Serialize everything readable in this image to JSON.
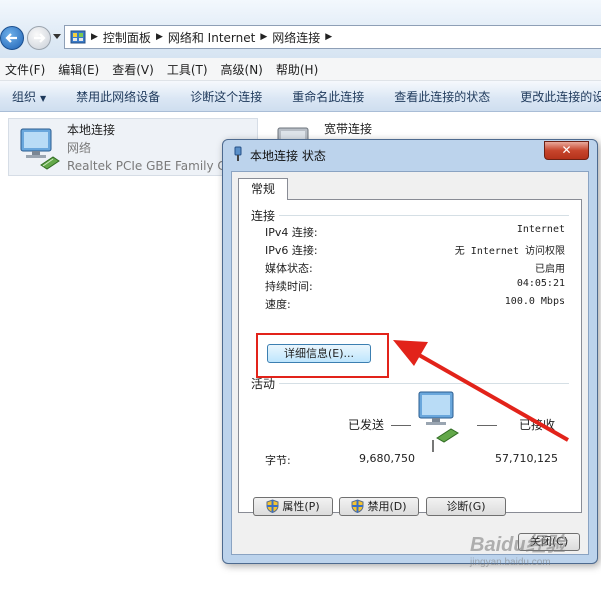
{
  "breadcrumbs": [
    "控制面板",
    "网络和 Internet",
    "网络连接"
  ],
  "menu": [
    "文件(F)",
    "编辑(E)",
    "查看(V)",
    "工具(T)",
    "高级(N)",
    "帮助(H)"
  ],
  "toolbar": {
    "organize": "组织",
    "items": [
      "禁用此网络设备",
      "诊断这个连接",
      "重命名此连接",
      "查看此连接的状态",
      "更改此连接的设"
    ]
  },
  "connections": {
    "local": {
      "name": "本地连接",
      "network": "网络",
      "adapter": "Realtek PCIe GBE Family Co"
    },
    "broadband": {
      "name": "宽带连接"
    }
  },
  "dialog": {
    "title": "本地连接 状态",
    "close": "✕",
    "tab": "常规",
    "connection_group": "连接",
    "rows": [
      {
        "label": "IPv4 连接:",
        "value": "Internet"
      },
      {
        "label": "IPv6 连接:",
        "value": "无 Internet 访问权限"
      },
      {
        "label": "媒体状态:",
        "value": "已启用"
      },
      {
        "label": "持续时间:",
        "value": "04:05:21"
      },
      {
        "label": "速度:",
        "value": "100.0 Mbps"
      }
    ],
    "details_button": "详细信息(E)...",
    "activity_group": "活动",
    "sent_label": "已发送",
    "received_label": "已接收",
    "bytes_label": "字节:",
    "bytes_sent": "9,680,750",
    "bytes_received": "57,710,125",
    "properties_button": "属性(P)",
    "disable_button": "禁用(D)",
    "diagnose_button": "诊断(G)",
    "close_button": "关闭(C)"
  },
  "watermark": {
    "brand": "Baidu经验",
    "url": "jingyan.baidu.com"
  },
  "colors": {
    "highlight": "#e2231a",
    "accent": "#1f62b5"
  }
}
